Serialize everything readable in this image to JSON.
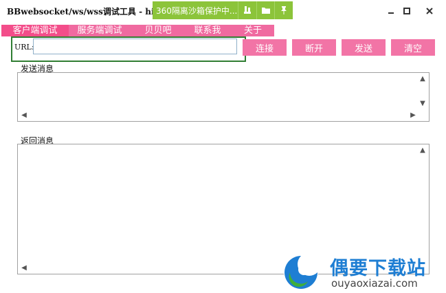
{
  "window": {
    "title": "BBwebsocket/ws/wss调试工具 - hi"
  },
  "sandbox": {
    "text": "360隔离沙箱保护中..."
  },
  "tabs": [
    "客户端调试",
    "服务端调试",
    "贝贝吧",
    "联系我",
    "关于"
  ],
  "url": {
    "label": "URL:",
    "value": ""
  },
  "buttons": {
    "connect": "连接",
    "disconnect": "断开",
    "send": "发送",
    "clear": "清空"
  },
  "send_label": "发送消息",
  "return_label": "返回消息",
  "watermark": {
    "title": "偶要下载站",
    "url": "ouyaoxiazai.com"
  },
  "colors": {
    "tab_bg": "#f06aa0",
    "tab_active": "#f34d8a",
    "button": "#f274a6",
    "sandbox": "#8cc43a",
    "highlight": "#2f7d32"
  }
}
